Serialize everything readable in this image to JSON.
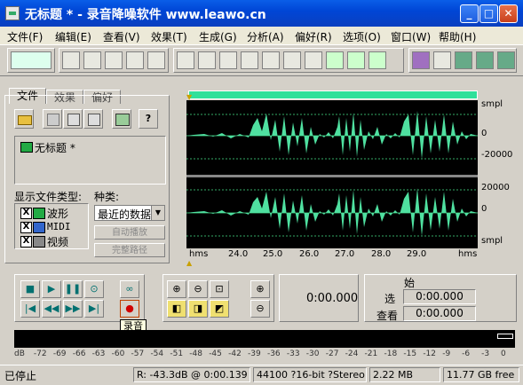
{
  "window": {
    "title": "无标题 * - 录音降噪软件 www.leawo.cn",
    "minimize": "_",
    "maximize": "□",
    "close": "✕"
  },
  "menu": [
    "文件(F)",
    "编辑(E)",
    "查看(V)",
    "效果(T)",
    "生成(G)",
    "分析(A)",
    "偏好(R)",
    "选项(O)",
    "窗口(W)",
    "帮助(H)"
  ],
  "panel": {
    "tabs": [
      "文件",
      "效果",
      "偏好"
    ],
    "file_item": "无标题 *",
    "show_types_label": "显示文件类型:",
    "kind_label": "种类:",
    "types": [
      {
        "label": "波形",
        "checked": true
      },
      {
        "label": "MIDI",
        "checked": true
      },
      {
        "label": "视频",
        "checked": true
      }
    ],
    "kind_value": "最近的数据",
    "auto_play": "自动播放",
    "full_path": "完整路径",
    "help_button": "?"
  },
  "waveform": {
    "units_top": "smpl",
    "ticks_top": [
      "0",
      "-20000"
    ],
    "ticks_bottom": [
      "20000",
      "0"
    ],
    "units_bottom": "smpl",
    "time_unit": "hms",
    "time_ticks": [
      "24.0",
      "25.0",
      "26.0",
      "27.0",
      "28.0",
      "29.0"
    ],
    "time_unit_right": "hms"
  },
  "transport": {
    "tooltip": "录音",
    "current_time": "0:00.000",
    "start_label": "始",
    "select_label": "选",
    "view_label": "查看",
    "select_start": "0:00.000",
    "view_start": "0:00.000"
  },
  "meter": {
    "ticks": [
      "dB",
      "-72",
      "-69",
      "-66",
      "-63",
      "-60",
      "-57",
      "-54",
      "-51",
      "-48",
      "-45",
      "-42",
      "-39",
      "-36",
      "-33",
      "-30",
      "-27",
      "-24",
      "-21",
      "-18",
      "-15",
      "-12",
      "-9",
      "-6",
      "-3",
      "0"
    ]
  },
  "status": {
    "state": "已停止",
    "level": "R: -43.3dB @  0:00.139",
    "format": "44100 ?16-bit ?Stereo",
    "size": "2.22 MB",
    "free": "11.77 GB free"
  },
  "colors": {
    "wave": "#4fe0a0",
    "record": "#d00000",
    "title": "#0a5ee8"
  }
}
